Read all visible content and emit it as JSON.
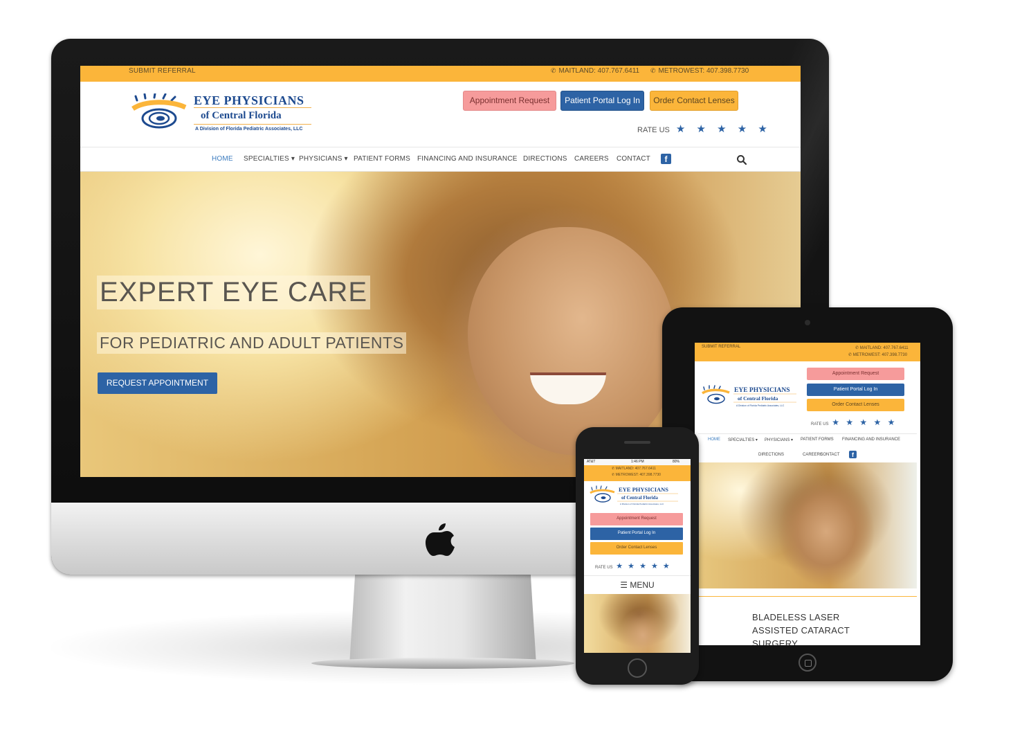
{
  "desktop": {
    "topbar": {
      "referral": "SUBMIT REFERRAL",
      "phone1": "MAITLAND: 407.767.6411",
      "phone2": "METROWEST: 407.398.7730"
    },
    "logo": {
      "title": "EYE PHYSICIANS",
      "subtitle": "of Central Florida",
      "division": "A Division of Florida Pediatric Associates, LLC"
    },
    "buttons": {
      "appointment": "Appointment Request",
      "portal": "Patient Portal Log In",
      "lenses": "Order Contact Lenses"
    },
    "rate_label": "RATE US",
    "stars": "★ ★ ★ ★ ★",
    "nav": [
      "HOME",
      "SPECIALTIES ▾",
      "PHYSICIANS ▾",
      "PATIENT FORMS",
      "FINANCING AND INSURANCE",
      "DIRECTIONS",
      "CAREERS",
      "CONTACT"
    ],
    "hero": {
      "title": "EXPERT EYE CARE",
      "subtitle": "FOR PEDIATRIC AND ADULT PATIENTS",
      "cta": "REQUEST APPOINTMENT"
    }
  },
  "tablet": {
    "referral": "SUBMIT REFERRAL",
    "phone1": "MAITLAND: 407.767.6411",
    "phone2": "METROWEST: 407.398.7730",
    "buttons": {
      "appointment": "Appointment Request",
      "portal": "Patient Portal Log In",
      "lenses": "Order Contact Lenses"
    },
    "rate_label": "RATE US",
    "stars": "★ ★ ★ ★ ★",
    "nav": [
      "HOME",
      "SPECIALTIES ▾",
      "PHYSICIANS ▾",
      "PATIENT FORMS",
      "FINANCING AND INSURANCE",
      "DIRECTIONS",
      "CAREERS",
      "CONTACT"
    ],
    "feature_text": [
      "BLADELESS LASER",
      "ASSISTED CATARACT",
      "SURGERY"
    ]
  },
  "phone": {
    "status": {
      "carrier": "AT&T",
      "time": "1:46 PM",
      "battery": "80%"
    },
    "phone1": "MAITLAND: 407.767.6411",
    "phone2": "METROWEST: 407.398.7730",
    "buttons": {
      "appointment": "Appointment Request",
      "portal": "Patient Portal Log In",
      "lenses": "Order Contact Lenses"
    },
    "rate_label": "RATE US",
    "stars": "★ ★ ★ ★ ★",
    "menu": "☰ MENU"
  },
  "colors": {
    "accent_orange": "#fbb53a",
    "brand_blue": "#2d63a5",
    "appointment_pink": "#f69b9b"
  }
}
